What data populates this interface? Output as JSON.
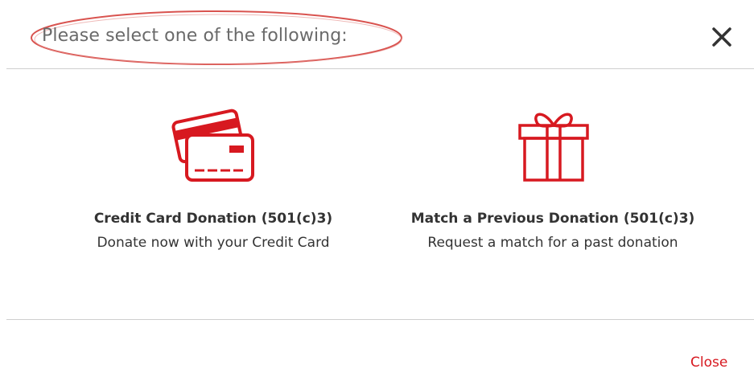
{
  "header": {
    "title": "Please select one of the following:"
  },
  "options": [
    {
      "title": "Credit Card Donation (501(c)3)",
      "subtitle": "Donate now with your Credit Card",
      "icon": "credit-card-icon"
    },
    {
      "title": "Match a Previous Donation (501(c)3)",
      "subtitle": "Request a match for a past donation",
      "icon": "gift-icon"
    }
  ],
  "footer": {
    "close_label": "Close"
  },
  "colors": {
    "accent": "#d71920",
    "text": "#333333",
    "title": "#6a6a6a",
    "divider": "#cfcfcf",
    "annotation": "#d9534f"
  }
}
